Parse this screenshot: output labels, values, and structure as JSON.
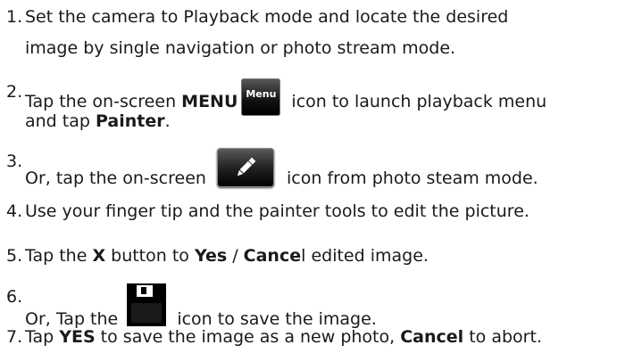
{
  "steps": [
    {
      "num": "1.",
      "line1": "Set the camera to Playback mode and locate the desired",
      "line2": "image by single navigation or photo stream mode."
    },
    {
      "num": "2.",
      "pre": "Tap the on-screen ",
      "bold1": "MENU",
      "icon_label": "Menu",
      "post": " icon to launch playback menu",
      "line2_pre": "and tap ",
      "line2_bold": "Painter",
      "line2_post": "."
    },
    {
      "num": "3.",
      "pre": "Or, tap the on-screen ",
      "icon": "pencil-icon",
      "post": " icon from photo steam mode."
    },
    {
      "num": "4.",
      "text": "Use your finger tip and the painter tools to edit the picture."
    },
    {
      "num": "5.",
      "pre": "Tap the ",
      "bold1": "X",
      "mid1": " button to ",
      "bold2": "Yes",
      "mid2": " / ",
      "bold3": "Cance",
      "post": "l edited image."
    },
    {
      "num": "6.",
      "pre": "Or, Tap the ",
      "icon": "save-floppy-icon",
      "post": " icon to save the image."
    },
    {
      "num": "7.",
      "pre": "Tap ",
      "bold1": "YES",
      "mid1": " to save the image as a new photo, ",
      "bold2": "Cancel",
      "post": " to abort."
    }
  ]
}
